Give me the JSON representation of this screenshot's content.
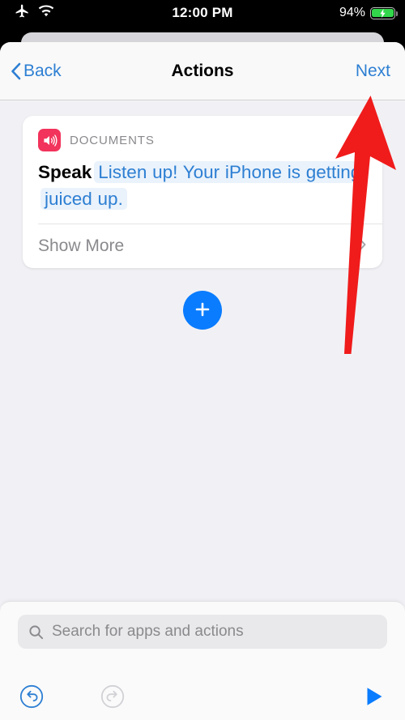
{
  "status_bar": {
    "airplane_icon": "airplane-mode-icon",
    "wifi_icon": "wifi-icon",
    "time": "12:00 PM",
    "battery_percent": "94%",
    "battery_state": "charging",
    "battery_color": "#32D74B"
  },
  "nav": {
    "back_label": "Back",
    "title": "Actions",
    "next_label": "Next",
    "tint_color": "#2D7FD3"
  },
  "action_card": {
    "app_label": "DOCUMENTS",
    "app_icon": "speaker-wave-icon",
    "app_icon_color": "#F2335B",
    "verb": "Speak",
    "token_text": "Listen up! Your iPhone is getting juiced up.",
    "token_color": "#2D7FD3",
    "token_bg": "#EAF2FB",
    "show_more_label": "Show More",
    "disclosure_icon": "chevron-right-icon"
  },
  "add_button": {
    "icon": "plus-icon",
    "color": "#0A7CFF"
  },
  "search": {
    "icon": "search-icon",
    "placeholder": "Search for apps and actions",
    "value": ""
  },
  "toolbar": {
    "undo_icon": "undo-circle-icon",
    "undo_enabled_color": "#0A7CFF",
    "redo_icon": "redo-circle-icon",
    "redo_disabled_color": "#D1D1D6",
    "play_icon": "play-triangle-icon",
    "play_color": "#0A7CFF"
  },
  "annotation": {
    "arrow_color": "#F01B1B",
    "points_to": "Next"
  }
}
